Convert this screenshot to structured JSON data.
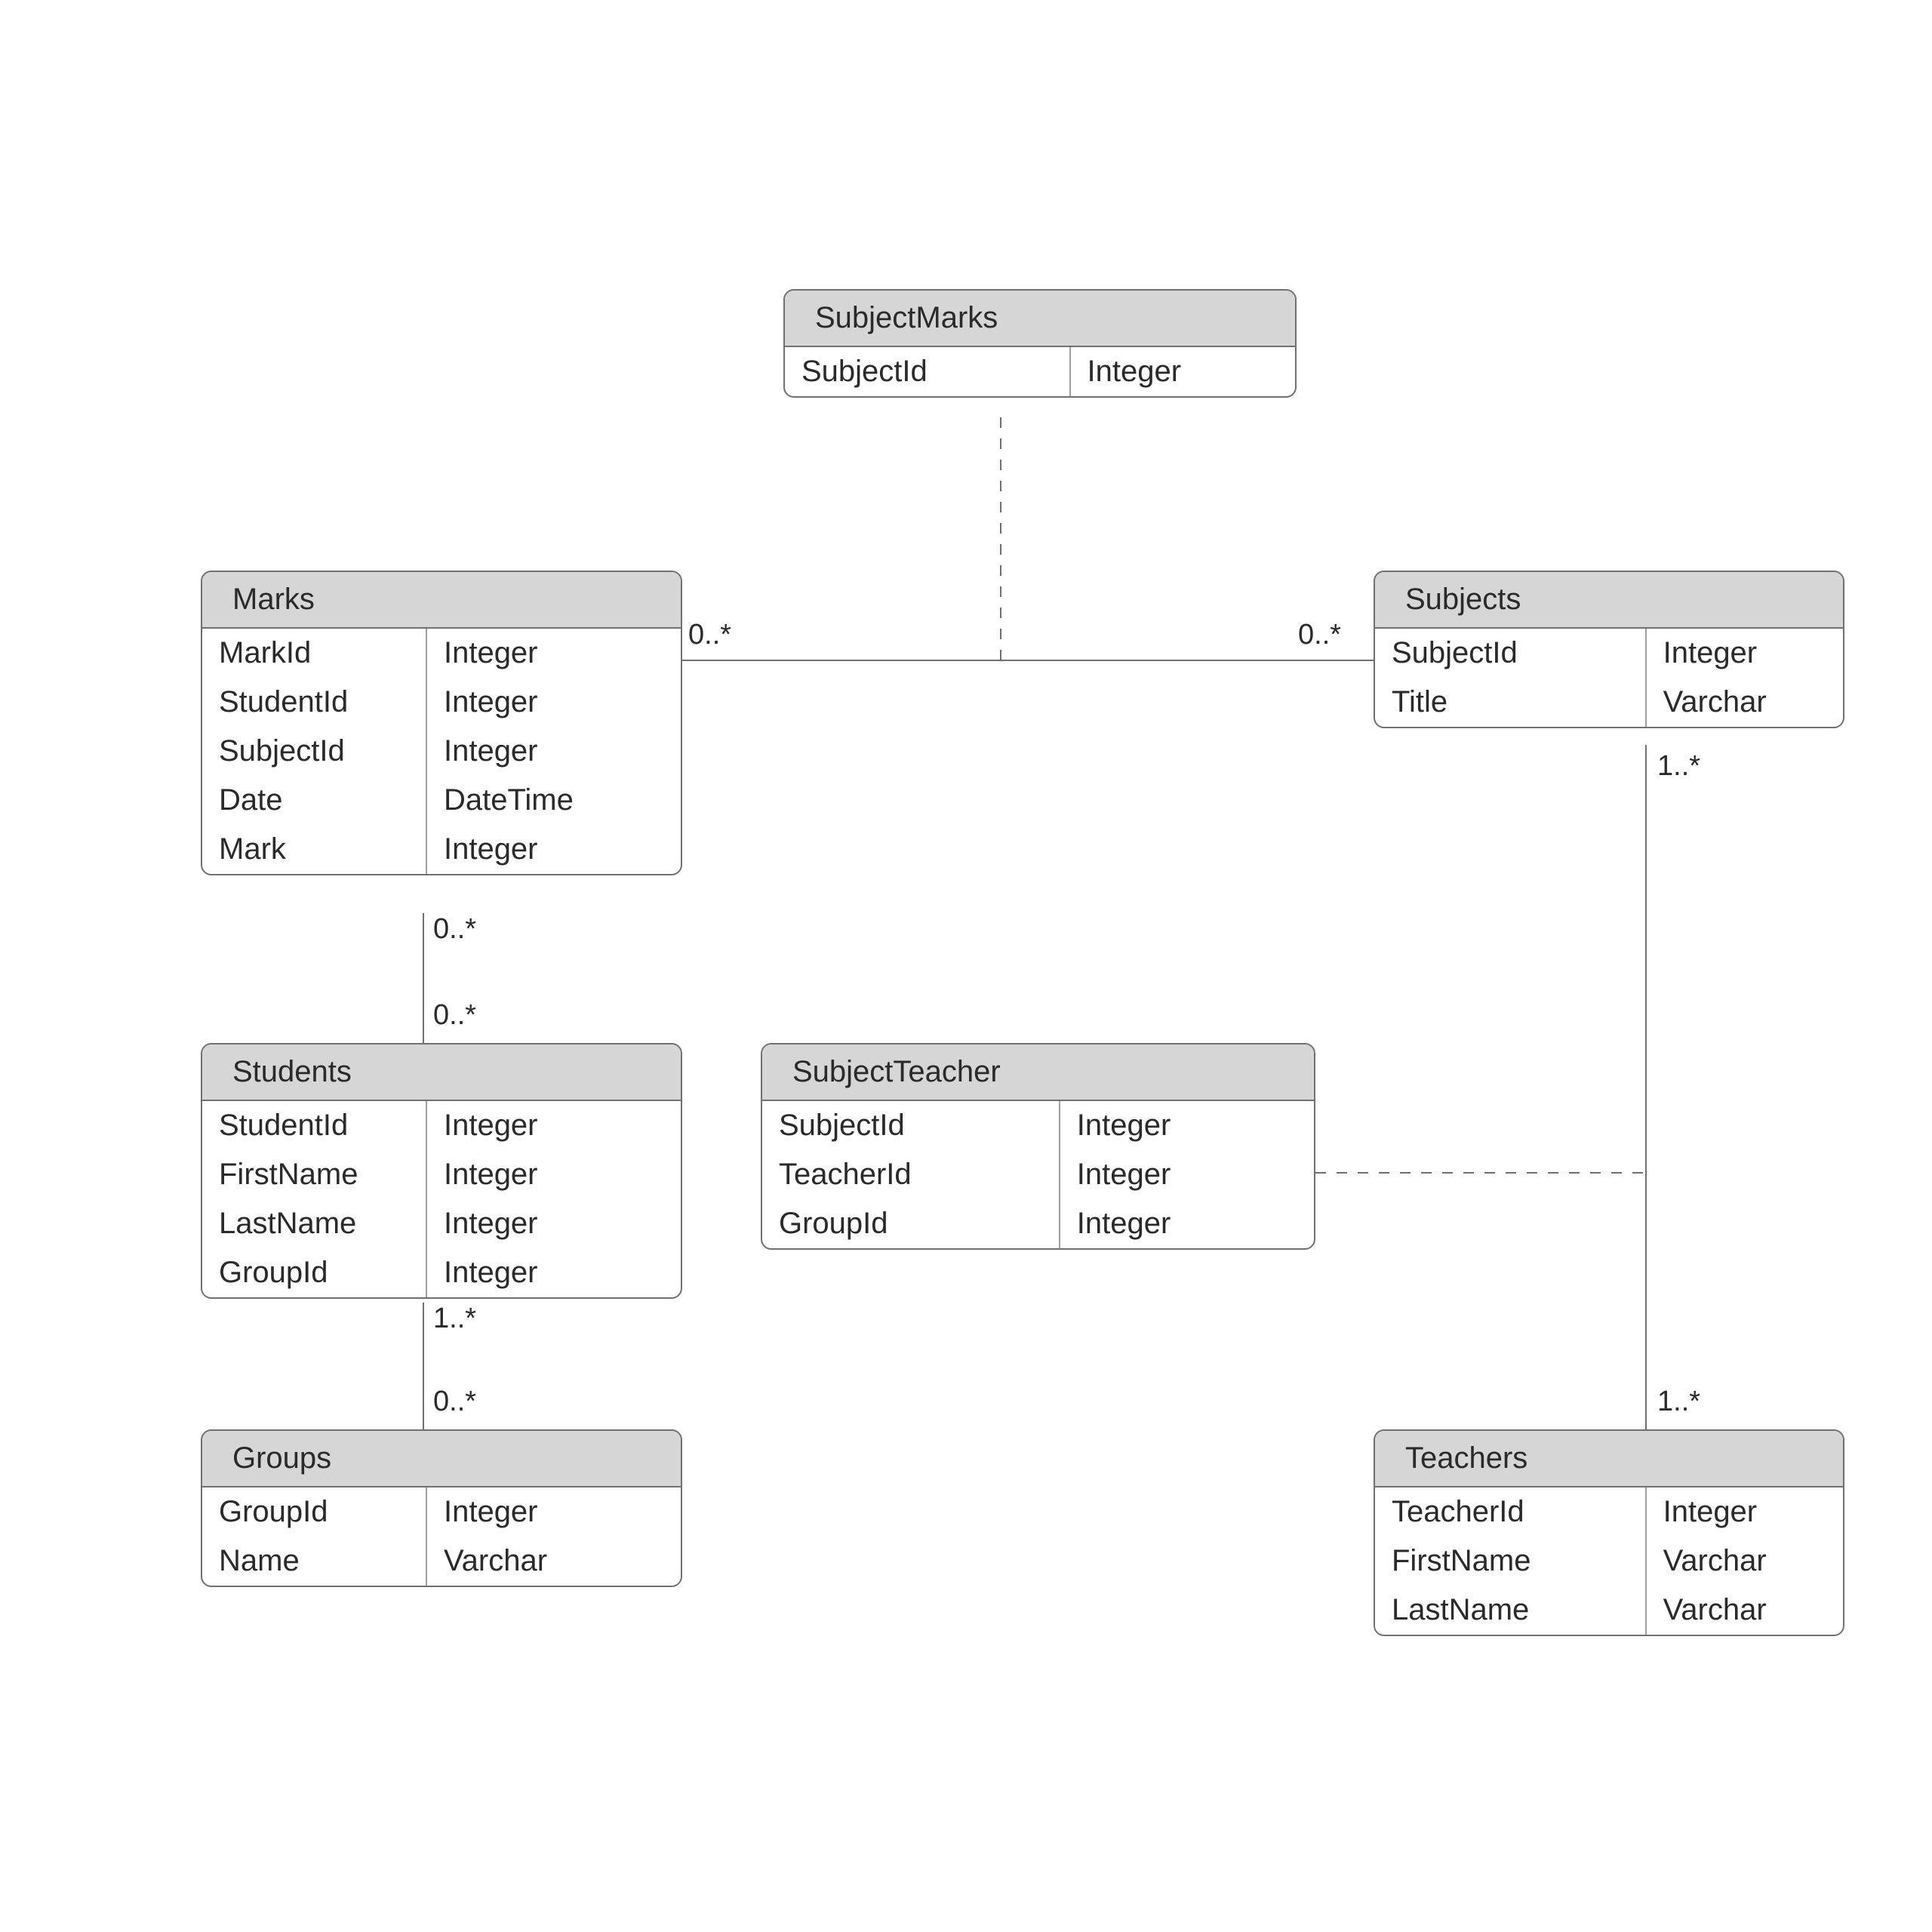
{
  "entities": {
    "subjectMarks": {
      "title": "SubjectMarks",
      "fields": [
        {
          "name": "SubjectId",
          "type": "Integer"
        }
      ]
    },
    "marks": {
      "title": "Marks",
      "fields": [
        {
          "name": "MarkId",
          "type": "Integer"
        },
        {
          "name": "StudentId",
          "type": "Integer"
        },
        {
          "name": "SubjectId",
          "type": "Integer"
        },
        {
          "name": "Date",
          "type": "DateTime"
        },
        {
          "name": "Mark",
          "type": "Integer"
        }
      ]
    },
    "subjects": {
      "title": "Subjects",
      "fields": [
        {
          "name": "SubjectId",
          "type": "Integer"
        },
        {
          "name": "Title",
          "type": "Varchar"
        }
      ]
    },
    "students": {
      "title": "Students",
      "fields": [
        {
          "name": "StudentId",
          "type": "Integer"
        },
        {
          "name": "FirstName",
          "type": "Integer"
        },
        {
          "name": "LastName",
          "type": "Integer"
        },
        {
          "name": "GroupId",
          "type": "Integer"
        }
      ]
    },
    "subjectTeacher": {
      "title": "SubjectTeacher",
      "fields": [
        {
          "name": "SubjectId",
          "type": "Integer"
        },
        {
          "name": "TeacherId",
          "type": "Integer"
        },
        {
          "name": "GroupId",
          "type": "Integer"
        }
      ]
    },
    "groups": {
      "title": "Groups",
      "fields": [
        {
          "name": "GroupId",
          "type": "Integer"
        },
        {
          "name": "Name",
          "type": "Varchar"
        }
      ]
    },
    "teachers": {
      "title": "Teachers",
      "fields": [
        {
          "name": "TeacherId",
          "type": "Integer"
        },
        {
          "name": "FirstName",
          "type": "Varchar"
        },
        {
          "name": "LastName",
          "type": "Varchar"
        }
      ]
    }
  },
  "multiplicities": {
    "marksSubjects": {
      "left": "0..*",
      "right": "0..*"
    },
    "marksStudents": {
      "top": "0..*",
      "bottom": "0..*"
    },
    "studentsGroups": {
      "top": "1..*",
      "bottom": "0..*"
    },
    "subjectsTeachers": {
      "top": "1..*",
      "bottom": "1..*"
    }
  },
  "relations": [
    {
      "from": "Marks",
      "to": "Subjects",
      "style": "solid",
      "via": "SubjectMarks"
    },
    {
      "from": "Marks",
      "to": "Students",
      "style": "solid"
    },
    {
      "from": "Students",
      "to": "Groups",
      "style": "solid"
    },
    {
      "from": "Subjects",
      "to": "Teachers",
      "style": "solid",
      "via": "SubjectTeacher"
    }
  ]
}
